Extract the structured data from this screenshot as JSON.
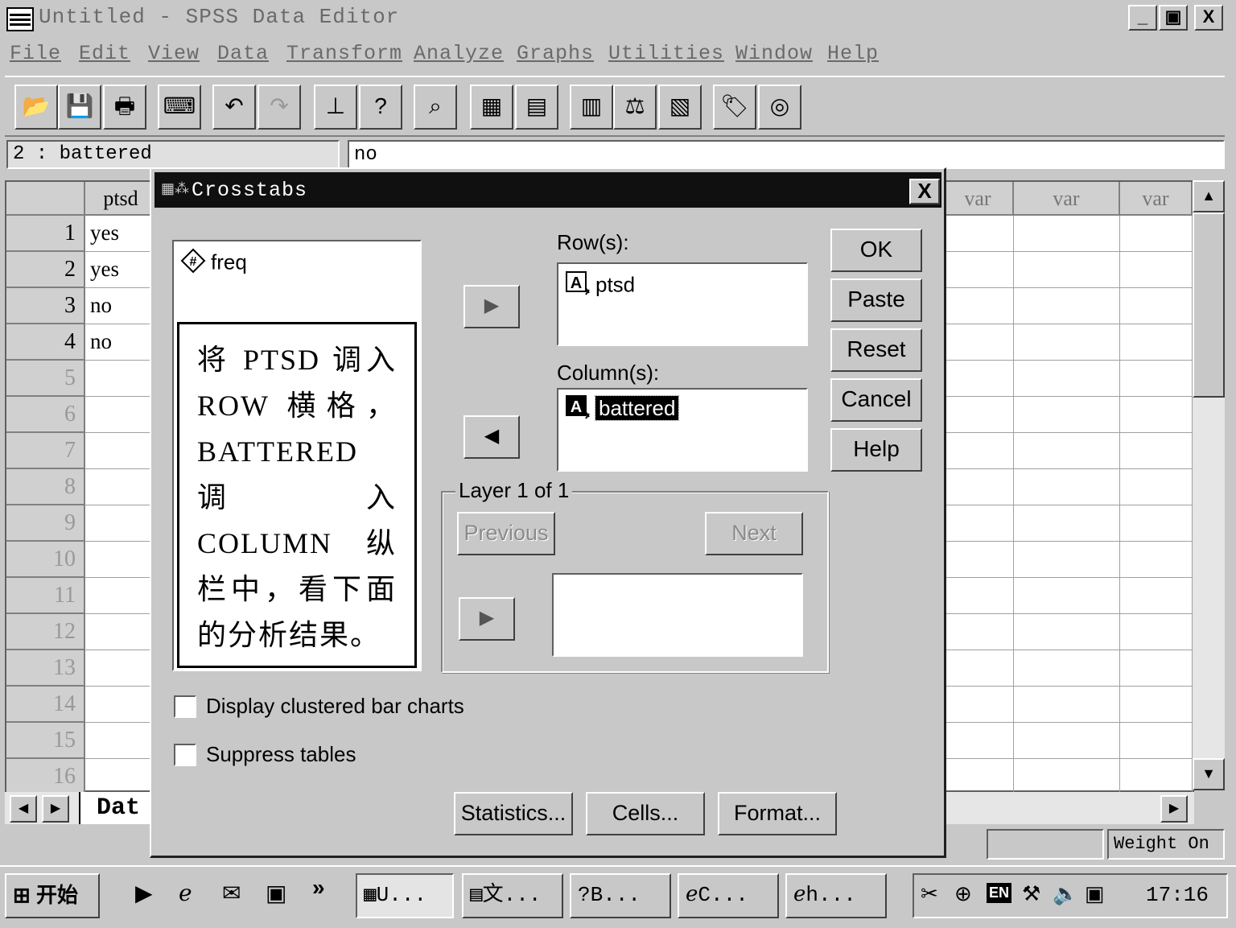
{
  "window": {
    "title": "Untitled - SPSS Data Editor",
    "minimize": "_",
    "maximize": "▣",
    "close": "X"
  },
  "menu": [
    "File",
    "Edit",
    "View",
    "Data",
    "Transform",
    "Analyze",
    "Graphs",
    "Utilities",
    "Window",
    "Help"
  ],
  "cellbar": {
    "ref": "2 : battered",
    "value": "no"
  },
  "grid": {
    "col1_header": "ptsd",
    "var_header": "var",
    "rows": [
      "1",
      "2",
      "3",
      "4",
      "5",
      "6",
      "7",
      "8",
      "9",
      "10",
      "11",
      "12",
      "13",
      "14",
      "15",
      "16"
    ],
    "ptsd_values": [
      "yes",
      "yes",
      "no",
      "no"
    ]
  },
  "sheet_tab": "Dat",
  "status": {
    "weight": "Weight On"
  },
  "dialog": {
    "title": "Crosstabs",
    "close": "X",
    "source_vars": [
      "freq"
    ],
    "note": "将 PTSD 调入 ROW 横格，BATTERED 调入 COLUMN 纵栏中，看下面的分析结果。",
    "rows_label": "Row(s):",
    "rows_vars": [
      "ptsd"
    ],
    "cols_label": "Column(s):",
    "cols_vars": [
      "battered"
    ],
    "layer_label": "Layer 1 of 1",
    "previous": "Previous",
    "next": "Next",
    "buttons": {
      "ok": "OK",
      "paste": "Paste",
      "reset": "Reset",
      "cancel": "Cancel",
      "help": "Help"
    },
    "checks": {
      "clustered": {
        "label": "Display clustered bar charts",
        "checked": false
      },
      "suppress": {
        "label": "Suppress tables",
        "checked": false
      }
    },
    "bottom_buttons": {
      "statistics": "Statistics...",
      "cells": "Cells...",
      "format": "Format..."
    }
  },
  "taskbar": {
    "start": "开始",
    "chevron": "»",
    "tasks": [
      "U...",
      "文...",
      "B...",
      "C...",
      "h..."
    ],
    "tray_lang": "EN",
    "clock": "17:16"
  }
}
